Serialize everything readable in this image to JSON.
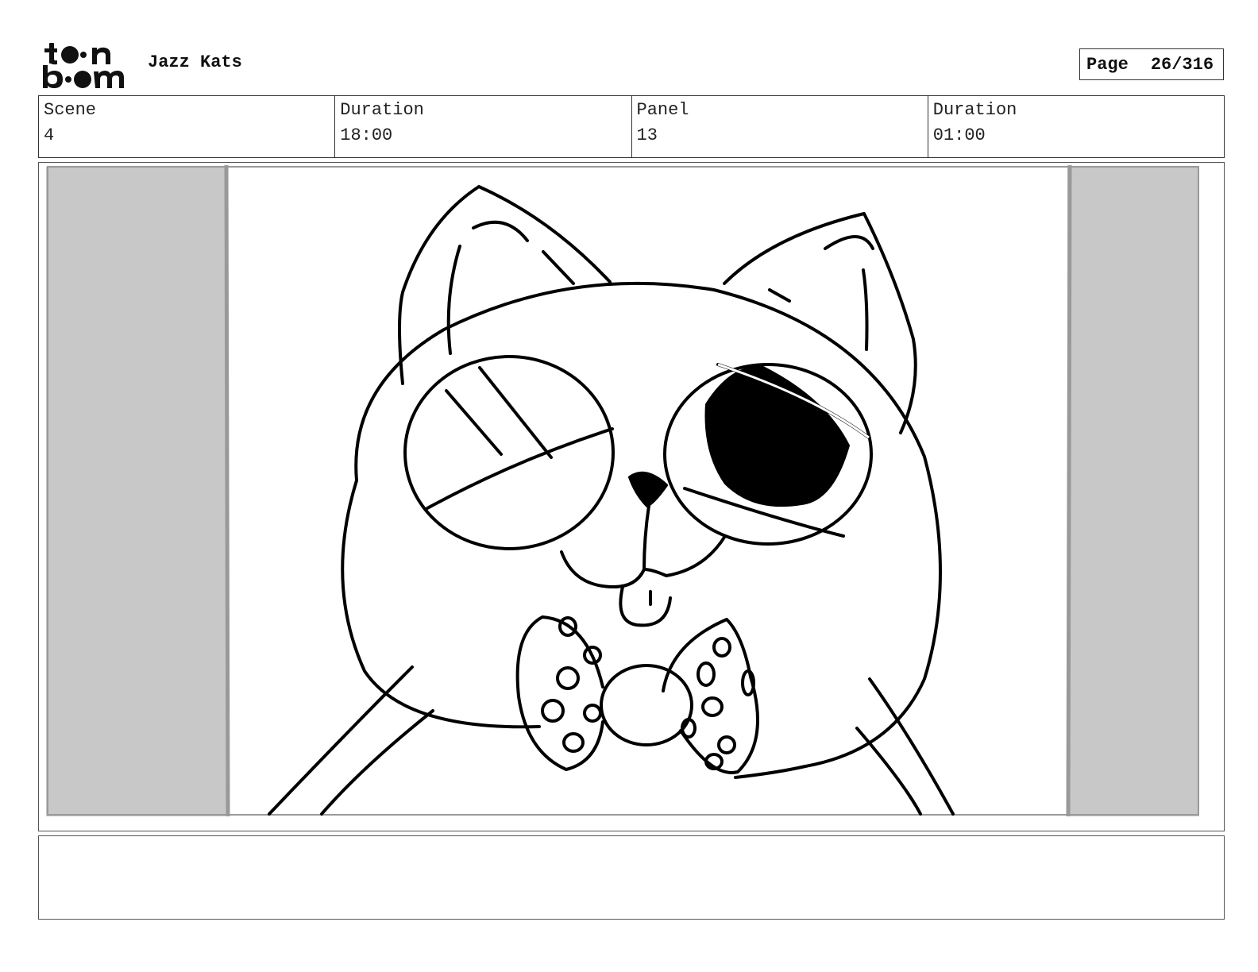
{
  "header": {
    "logo_text": "toon boom",
    "project_title": "Jazz Kats",
    "page_label": "Page",
    "page_number": "26/316"
  },
  "info": [
    {
      "label": "Scene",
      "value": "4"
    },
    {
      "label": "Duration",
      "value": "18:00"
    },
    {
      "label": "Panel",
      "value": "13"
    },
    {
      "label": "Duration",
      "value": "01:00"
    }
  ],
  "panel": {
    "subject_icon": "cat-with-bowtie-sketch"
  },
  "notes": {
    "text": ""
  }
}
